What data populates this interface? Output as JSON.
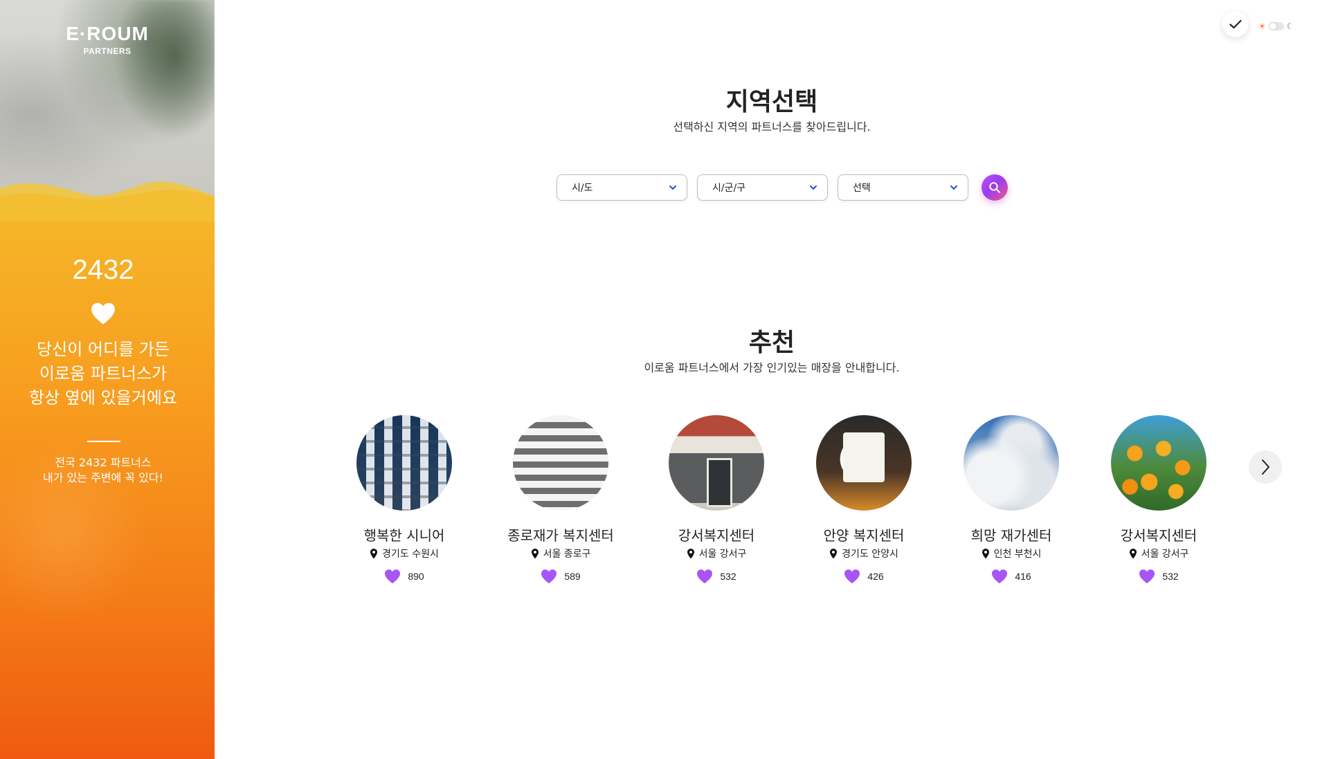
{
  "brand": {
    "logo_text": "E·ROUM",
    "logo_sub": "PARTNERS"
  },
  "sidebar": {
    "count": "2432",
    "slogan_lines": [
      "당신이 어디를 가든",
      "이로움 파트너스가",
      "항상 옆에 있을거에요"
    ],
    "note_lines": [
      "전국 2432 파트너스",
      "내가 있는 주변에 꼭 있다!"
    ]
  },
  "region": {
    "title": "지역선택",
    "desc": "선택하신 지역의 파트너스를 찾아드립니다.",
    "selects": [
      {
        "value": "시/도"
      },
      {
        "value": "시/군/구"
      },
      {
        "value": "선택"
      }
    ]
  },
  "recommend": {
    "title": "추천",
    "desc": "이로움 파트너스에서 가장 인기있는 매장을 안내합니다.",
    "cards": [
      {
        "name": "행복한 시니어",
        "location": "경기도 수원시",
        "likes": "890",
        "image": "building"
      },
      {
        "name": "종로재가 복지센터",
        "location": "서울 종로구",
        "likes": "589",
        "image": "crosswalk"
      },
      {
        "name": "강서복지센터",
        "location": "서울 강서구",
        "likes": "532",
        "image": "storefront"
      },
      {
        "name": "안양 복지센터",
        "location": "경기도 안양시",
        "likes": "426",
        "image": "sign"
      },
      {
        "name": "희망 재가센터",
        "location": "인천 부천시",
        "likes": "416",
        "image": "sky"
      },
      {
        "name": "강서복지센터",
        "location": "서울 강서구",
        "likes": "532",
        "image": "flowers"
      }
    ]
  },
  "colors": {
    "accent_purple": "#a855f7",
    "sidebar_top": "#f3c638",
    "sidebar_bottom": "#ef5a10",
    "select_chevron": "#1a4fd6"
  },
  "icons": {
    "check": "check-icon",
    "sun": "sun-icon",
    "moon": "moon-icon",
    "search": "search-icon",
    "chevron": "chevron-down-icon",
    "location": "location-pin-icon",
    "heart": "heart-icon",
    "next": "chevron-right-icon"
  }
}
